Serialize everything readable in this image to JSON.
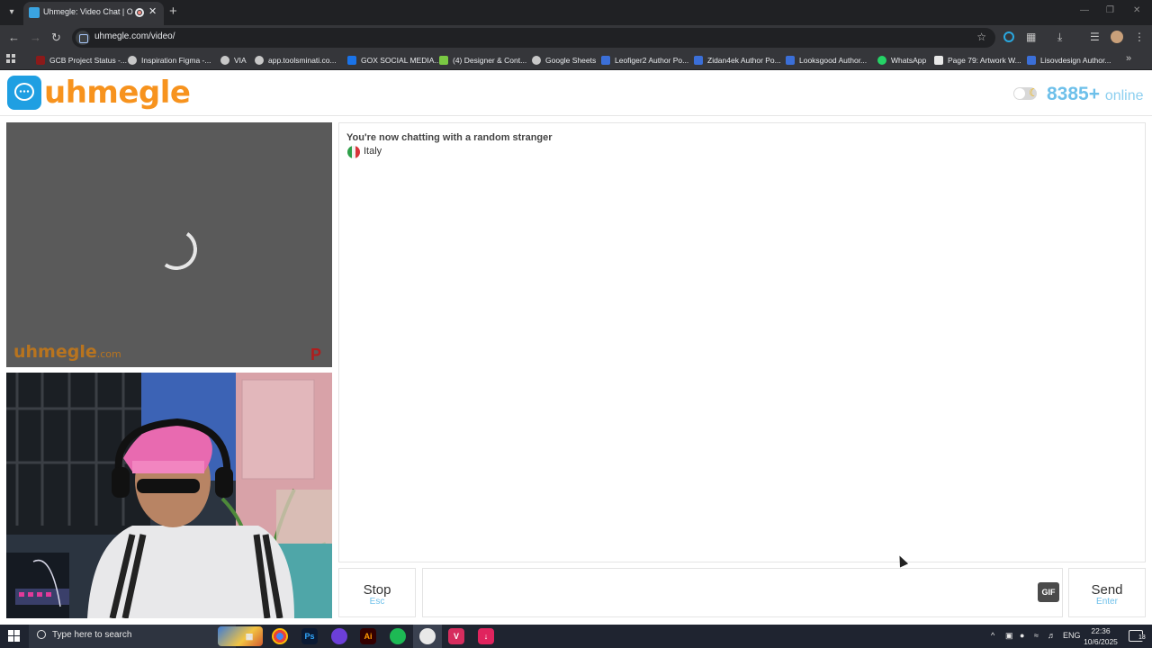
{
  "browser": {
    "tab_title": "Uhmegle: Video Chat | Omegle",
    "url": "uhmegle.com/video/",
    "bookmarks": [
      {
        "label": "GCB Project Status -...",
        "color": "#8b1a1a"
      },
      {
        "label": "Inspiration Figma -...",
        "color": "#c8c8c8"
      },
      {
        "label": "VIA",
        "color": "#c8c8c8"
      },
      {
        "label": "app.toolsminati.co...",
        "color": "#c8c8c8"
      },
      {
        "label": "GOX SOCIAL MEDIA...",
        "color": "#1a73e8"
      },
      {
        "label": "(4) Designer & Cont...",
        "color": "#7ac943"
      },
      {
        "label": "Google Sheets",
        "color": "#c8c8c8"
      },
      {
        "label": "Leofiger2 Author Po...",
        "color": "#3b6fd8"
      },
      {
        "label": "Zidan4ek Author Po...",
        "color": "#3b6fd8"
      },
      {
        "label": "Looksgood Author...",
        "color": "#3b6fd8"
      },
      {
        "label": "WhatsApp",
        "color": "#25d366"
      },
      {
        "label": "Page 79: Artwork W...",
        "color": "#e8e8e8"
      },
      {
        "label": "Lisovdesign Author...",
        "color": "#3b6fd8"
      }
    ]
  },
  "site": {
    "logo_text": "uhmegle",
    "online_count": "8385+",
    "online_label": "online",
    "watermark": "uhmegle",
    "watermark_suffix": ".com"
  },
  "chat": {
    "status": "You're now chatting with a random stranger",
    "country": "Italy",
    "message_placeholder": ""
  },
  "controls": {
    "stop_label": "Stop",
    "stop_key": "Esc",
    "send_label": "Send",
    "send_key": "Enter",
    "gif_label": "GIF"
  },
  "taskbar": {
    "search_placeholder": "Type here to search",
    "language": "ENG",
    "time": "22:36",
    "date": "10/6/2025",
    "notification_count": "18"
  },
  "colors": {
    "brand_orange": "#f7931e",
    "brand_blue": "#1f9fe2",
    "online_blue": "#6ec0ea"
  }
}
